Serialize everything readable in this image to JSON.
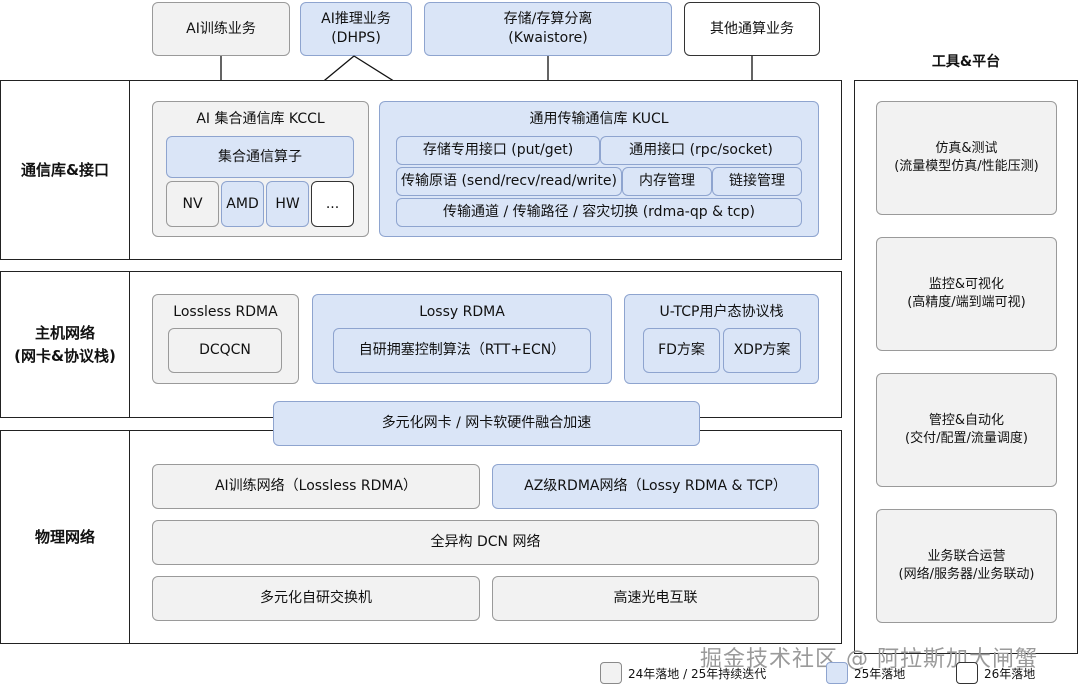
{
  "top": {
    "ai_training": "AI训练业务",
    "ai_inference": "AI推理业务\n(DHPS)",
    "storage": "存储/存算分离\n(Kwaistore)",
    "other": "其他通算业务"
  },
  "tools": {
    "title": "工具&平台",
    "items": [
      "仿真&测试\n(流量模型仿真/性能压测)",
      "监控&可视化\n(高精度/端到端可视)",
      "管控&自动化\n(交付/配置/流量调度)",
      "业务联合运营\n(网络/服务器/业务联动)"
    ]
  },
  "comm": {
    "label": "通信库&接口",
    "kccl": {
      "title": "AI 集合通信库 KCCL",
      "operator": "集合通信算子",
      "vendors": [
        "NV",
        "AMD",
        "HW",
        "..."
      ]
    },
    "kucl": {
      "title": "通用传输通信库 KUCL",
      "storage_api": "存储专用接口 (put/get)",
      "general_api": "通用接口 (rpc/socket)",
      "primitives": "传输原语 (send/recv/read/write)",
      "memory": "内存管理",
      "link": "链接管理",
      "channel": "传输通道 / 传输路径 / 容灾切换 (rdma-qp & tcp)"
    }
  },
  "host": {
    "label": "主机网络\n(网卡&协议栈)",
    "lossless": {
      "title": "Lossless RDMA",
      "item": "DCQCN"
    },
    "lossy": {
      "title": "Lossy RDMA",
      "item": "自研拥塞控制算法（RTT+ECN）"
    },
    "utcp": {
      "title": "U-TCP用户态协议栈",
      "items": [
        "FD方案",
        "XDP方案"
      ]
    },
    "nic": "多元化网卡 / 网卡软硬件融合加速"
  },
  "physical": {
    "label": "物理网络",
    "ai_net": "AI训练网络（Lossless RDMA）",
    "az_net": "AZ级RDMA网络（Lossy RDMA & TCP）",
    "dcn": "全异构 DCN 网络",
    "switch": "多元化自研交换机",
    "optical": "高速光电互联"
  },
  "legend": {
    "items": [
      {
        "label": "24年落地 / 25年持续迭代",
        "color": "#f2f2f2"
      },
      {
        "label": "25年落地",
        "color": "#dae5f7"
      },
      {
        "label": "26年落地",
        "color": "#ffffff"
      }
    ]
  },
  "watermark": "掘金技术社区 @ 阿拉斯加大闸蟹"
}
